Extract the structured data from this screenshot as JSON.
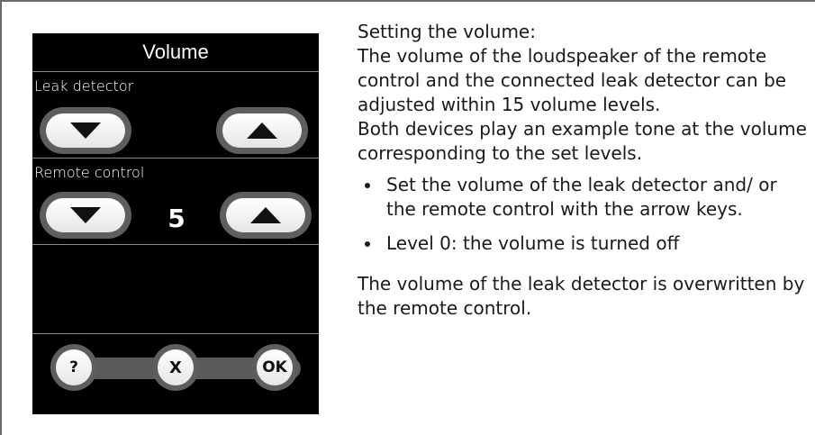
{
  "device": {
    "title": "Volume",
    "leak_section_label": "Leak detector",
    "remote_section_label": "Remote control",
    "remote_level": "5",
    "buttons": {
      "help": "?",
      "cancel": "X",
      "ok": "OK"
    },
    "icons": [
      "arrow-down-icon",
      "arrow-up-icon"
    ]
  },
  "instructions": {
    "heading": "Setting the volume:",
    "intro": "The volume of the loudspeaker of the remote control and the connected leak detector can be adjusted within 15 volume levels.",
    "example": "Both devices play an example tone at the volume corresponding to the set levels.",
    "bullets": [
      "Set the volume of the leak detector and/ or the remote control with the arrow keys.",
      "Level 0: the volume is turned off"
    ],
    "note": "The volume of the leak detector is overwritten by the remote control."
  }
}
